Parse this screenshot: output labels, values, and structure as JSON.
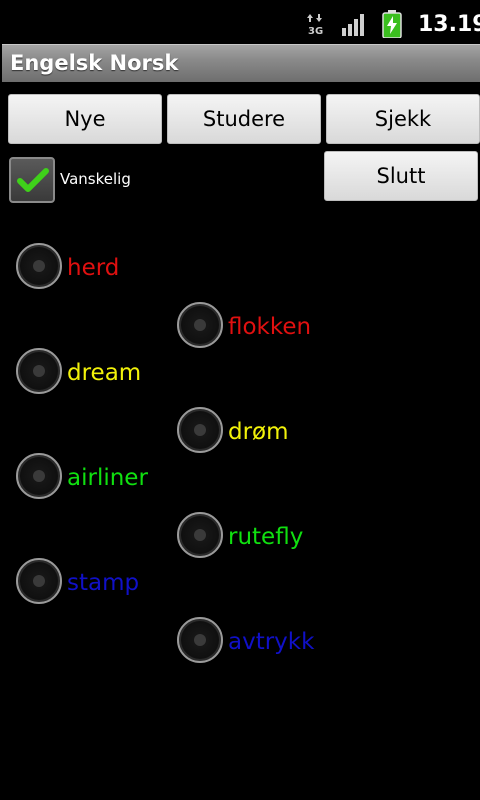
{
  "status": {
    "network_icon": "3g-data-icon",
    "signal_icon": "signal-strength-icon",
    "battery_icon": "battery-charging-icon",
    "time": "13.19"
  },
  "app": {
    "title": "Engelsk Norsk"
  },
  "buttons": {
    "new": "Nye",
    "study": "Studere",
    "check": "Sjekk",
    "quit": "Slutt"
  },
  "difficult": {
    "label": "Vanskelig",
    "checked": true
  },
  "colors": {
    "red": "#e01010",
    "yellow": "#f2f20a",
    "green": "#10e010",
    "blue": "#1010c8"
  },
  "pairs": [
    {
      "english": "herd",
      "norwegian": "flokken",
      "color": "#e01010"
    },
    {
      "english": "dream",
      "norwegian": "drøm",
      "color": "#f2f20a"
    },
    {
      "english": "airliner",
      "norwegian": "rutefly",
      "color": "#10e010"
    },
    {
      "english": "stamp",
      "norwegian": "avtrykk",
      "color": "#1010c8"
    }
  ]
}
